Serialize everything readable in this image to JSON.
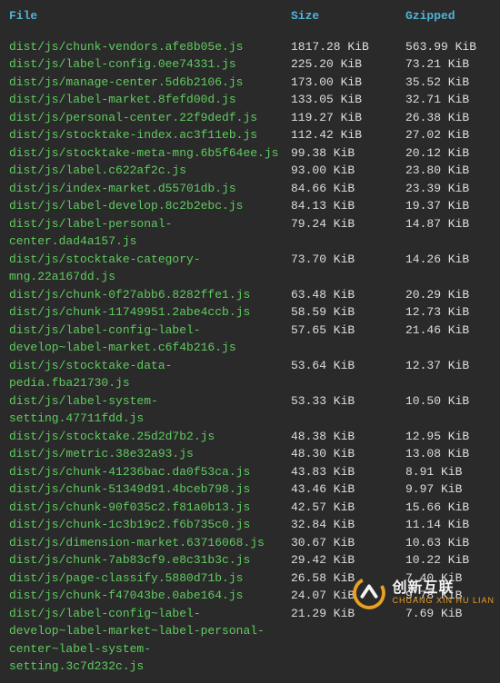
{
  "headers": {
    "file": "File",
    "size": "Size",
    "gzip": "Gzipped"
  },
  "rows": [
    {
      "file": "dist/js/chunk-vendors.afe8b05e.js",
      "size": "1817.28 KiB",
      "gzip": "563.99 KiB"
    },
    {
      "file": "dist/js/label-config.0ee74331.js",
      "size": "225.20 KiB",
      "gzip": "73.21 KiB"
    },
    {
      "file": "dist/js/manage-center.5d6b2106.js",
      "size": "173.00 KiB",
      "gzip": "35.52 KiB"
    },
    {
      "file": "dist/js/label-market.8fefd00d.js",
      "size": "133.05 KiB",
      "gzip": "32.71 KiB"
    },
    {
      "file": "dist/js/personal-center.22f9dedf.js",
      "size": "119.27 KiB",
      "gzip": "26.38 KiB"
    },
    {
      "file": "dist/js/stocktake-index.ac3f11eb.js",
      "size": "112.42 KiB",
      "gzip": "27.02 KiB"
    },
    {
      "file": "dist/js/stocktake-meta-mng.6b5f64ee.js",
      "size": "99.38 KiB",
      "gzip": "20.12 KiB"
    },
    {
      "file": "dist/js/label.c622af2c.js",
      "size": "93.00 KiB",
      "gzip": "23.80 KiB"
    },
    {
      "file": "dist/js/index-market.d55701db.js",
      "size": "84.66 KiB",
      "gzip": "23.39 KiB"
    },
    {
      "file": "dist/js/label-develop.8c2b2ebc.js",
      "size": "84.13 KiB",
      "gzip": "19.37 KiB"
    },
    {
      "file": "dist/js/label-personal-center.dad4a157.js",
      "size": "79.24 KiB",
      "gzip": "14.87 KiB"
    },
    {
      "file": "dist/js/stocktake-category-mng.22a167dd.js",
      "size": "73.70 KiB",
      "gzip": "14.26 KiB"
    },
    {
      "file": "dist/js/chunk-0f27abb6.8282ffe1.js",
      "size": "63.48 KiB",
      "gzip": "20.29 KiB"
    },
    {
      "file": "dist/js/chunk-11749951.2abe4ccb.js",
      "size": "58.59 KiB",
      "gzip": "12.73 KiB"
    },
    {
      "file": "dist/js/label-config~label-develop~label-market.c6f4b216.js",
      "size": "57.65 KiB",
      "gzip": "21.46 KiB"
    },
    {
      "file": "dist/js/stocktake-data-pedia.fba21730.js",
      "size": "53.64 KiB",
      "gzip": "12.37 KiB"
    },
    {
      "file": "dist/js/label-system-setting.47711fdd.js",
      "size": "53.33 KiB",
      "gzip": "10.50 KiB"
    },
    {
      "file": "dist/js/stocktake.25d2d7b2.js",
      "size": "48.38 KiB",
      "gzip": "12.95 KiB"
    },
    {
      "file": "dist/js/metric.38e32a93.js",
      "size": "48.30 KiB",
      "gzip": "13.08 KiB"
    },
    {
      "file": "dist/js/chunk-41236bac.da0f53ca.js",
      "size": "43.83 KiB",
      "gzip": "8.91 KiB"
    },
    {
      "file": "dist/js/chunk-51349d91.4bceb798.js",
      "size": "43.46 KiB",
      "gzip": "9.97 KiB"
    },
    {
      "file": "dist/js/chunk-90f035c2.f81a0b13.js",
      "size": "42.57 KiB",
      "gzip": "15.66 KiB"
    },
    {
      "file": "dist/js/chunk-1c3b19c2.f6b735c0.js",
      "size": "32.84 KiB",
      "gzip": "11.14 KiB"
    },
    {
      "file": "dist/js/dimension-market.63716068.js",
      "size": "30.67 KiB",
      "gzip": "10.63 KiB"
    },
    {
      "file": "dist/js/chunk-7ab83cf9.e8c31b3c.js",
      "size": "29.42 KiB",
      "gzip": "10.22 KiB"
    },
    {
      "file": "dist/js/page-classify.5880d71b.js",
      "size": "26.58 KiB",
      "gzip": "7.40 KiB"
    },
    {
      "file": "dist/js/chunk-f47043be.0abe164.js",
      "size": "24.07 KiB",
      "gzip": "9.78 KiB"
    },
    {
      "file": "dist/js/label-config~label-develop~label-market~label-personal-center~label-system-setting.3c7d232c.js",
      "size": "21.29 KiB",
      "gzip": "7.69 KiB"
    }
  ],
  "watermark": {
    "cn": "创新互联",
    "py": "CHUANG XIN HU LIAN"
  }
}
